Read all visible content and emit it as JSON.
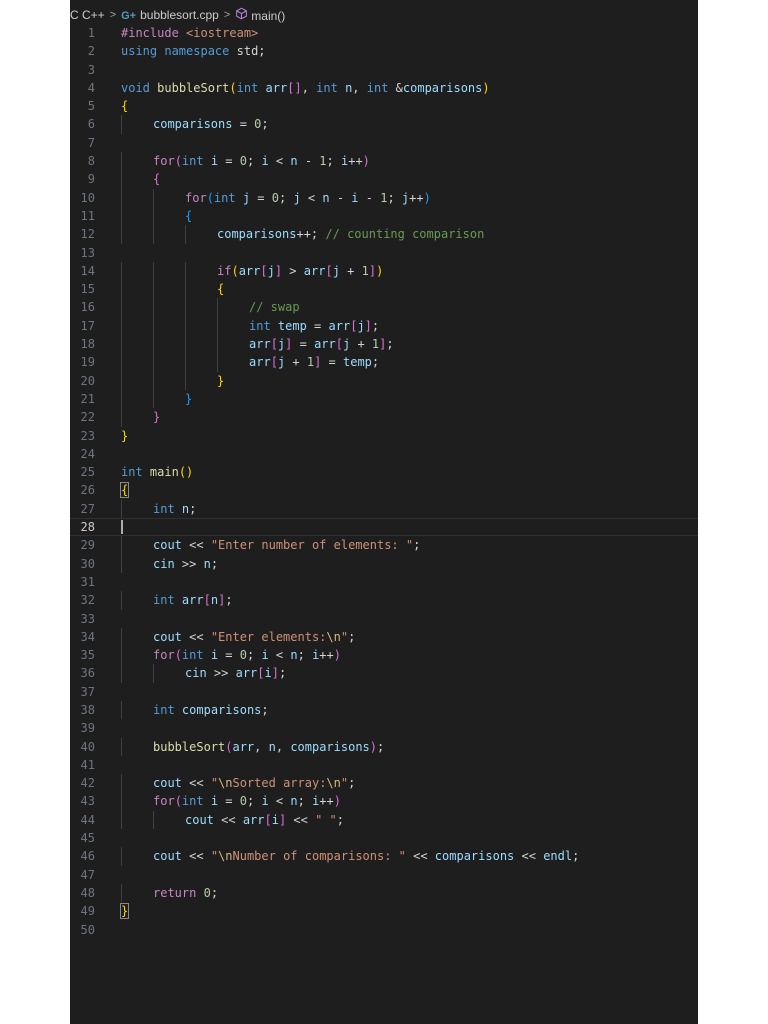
{
  "breadcrumb": {
    "items": [
      {
        "label": "C C++",
        "icon": null
      },
      {
        "label": "bubblesort.cpp",
        "icon": "cpp-file-icon"
      },
      {
        "label": "main()",
        "icon": "method-symbol-icon"
      }
    ],
    "separator": ">"
  },
  "editor": {
    "active_line": 28,
    "cursor_line": 28,
    "theme_colors": {
      "background": "#1e1e1e",
      "line_number": "#6e7681",
      "keyword": "#569cd6",
      "control": "#c586c0",
      "function": "#dcdcaa",
      "variable": "#9cdcfe",
      "number": "#b5cea8",
      "string": "#ce9178",
      "comment": "#6a9955"
    },
    "lines": [
      {
        "n": "1",
        "tokens": [
          [
            "pp",
            "#include "
          ],
          [
            "inc",
            "<iostream>"
          ]
        ]
      },
      {
        "n": "2",
        "tokens": [
          [
            "kw",
            "using"
          ],
          [
            "p",
            " "
          ],
          [
            "kw",
            "namespace"
          ],
          [
            "p",
            " std;"
          ]
        ]
      },
      {
        "n": "3",
        "tokens": []
      },
      {
        "n": "4",
        "tokens": [
          [
            "kw",
            "void"
          ],
          [
            "p",
            " "
          ],
          [
            "fn",
            "bubbleSort"
          ],
          [
            "b1",
            "("
          ],
          [
            "kw",
            "int"
          ],
          [
            "p",
            " "
          ],
          [
            "var",
            "arr"
          ],
          [
            "b2",
            "[]"
          ],
          [
            "p",
            ", "
          ],
          [
            "kw",
            "int"
          ],
          [
            "p",
            " "
          ],
          [
            "var",
            "n"
          ],
          [
            "p",
            ", "
          ],
          [
            "kw",
            "int"
          ],
          [
            "p",
            " &"
          ],
          [
            "var",
            "comparisons"
          ],
          [
            "b1",
            ")"
          ]
        ]
      },
      {
        "n": "5",
        "tokens": [
          [
            "b1",
            "{"
          ]
        ]
      },
      {
        "n": "6",
        "indent": 1,
        "tokens": [
          [
            "var",
            "comparisons"
          ],
          [
            "p",
            " = "
          ],
          [
            "num",
            "0"
          ],
          [
            "p",
            ";"
          ]
        ]
      },
      {
        "n": "7",
        "tokens": []
      },
      {
        "n": "8",
        "indent": 1,
        "tokens": [
          [
            "ctl",
            "for"
          ],
          [
            "b2",
            "("
          ],
          [
            "kw",
            "int"
          ],
          [
            "p",
            " "
          ],
          [
            "var",
            "i"
          ],
          [
            "p",
            " = "
          ],
          [
            "num",
            "0"
          ],
          [
            "p",
            "; "
          ],
          [
            "var",
            "i"
          ],
          [
            "p",
            " < "
          ],
          [
            "var",
            "n"
          ],
          [
            "p",
            " - "
          ],
          [
            "num",
            "1"
          ],
          [
            "p",
            "; "
          ],
          [
            "var",
            "i"
          ],
          [
            "p",
            "++"
          ],
          [
            "b2",
            ")"
          ]
        ]
      },
      {
        "n": "9",
        "indent": 1,
        "tokens": [
          [
            "b2",
            "{"
          ]
        ]
      },
      {
        "n": "10",
        "indent": 2,
        "tokens": [
          [
            "ctl",
            "for"
          ],
          [
            "b3",
            "("
          ],
          [
            "kw",
            "int"
          ],
          [
            "p",
            " "
          ],
          [
            "var",
            "j"
          ],
          [
            "p",
            " = "
          ],
          [
            "num",
            "0"
          ],
          [
            "p",
            "; "
          ],
          [
            "var",
            "j"
          ],
          [
            "p",
            " < "
          ],
          [
            "var",
            "n"
          ],
          [
            "p",
            " - "
          ],
          [
            "var",
            "i"
          ],
          [
            "p",
            " - "
          ],
          [
            "num",
            "1"
          ],
          [
            "p",
            "; "
          ],
          [
            "var",
            "j"
          ],
          [
            "p",
            "++"
          ],
          [
            "b3",
            ")"
          ]
        ]
      },
      {
        "n": "11",
        "indent": 2,
        "tokens": [
          [
            "b3",
            "{"
          ]
        ]
      },
      {
        "n": "12",
        "indent": 3,
        "tokens": [
          [
            "var",
            "comparisons"
          ],
          [
            "p",
            "++; "
          ],
          [
            "cmt",
            "// counting comparison"
          ]
        ]
      },
      {
        "n": "13",
        "tokens": []
      },
      {
        "n": "14",
        "indent": 3,
        "tokens": [
          [
            "ctl",
            "if"
          ],
          [
            "b1",
            "("
          ],
          [
            "var",
            "arr"
          ],
          [
            "b2",
            "["
          ],
          [
            "var",
            "j"
          ],
          [
            "b2",
            "]"
          ],
          [
            "p",
            " > "
          ],
          [
            "var",
            "arr"
          ],
          [
            "b2",
            "["
          ],
          [
            "var",
            "j"
          ],
          [
            "p",
            " + "
          ],
          [
            "num",
            "1"
          ],
          [
            "b2",
            "]"
          ],
          [
            "b1",
            ")"
          ]
        ]
      },
      {
        "n": "15",
        "indent": 3,
        "tokens": [
          [
            "b1",
            "{"
          ]
        ]
      },
      {
        "n": "16",
        "indent": 4,
        "tokens": [
          [
            "cmt",
            "// swap"
          ]
        ]
      },
      {
        "n": "17",
        "indent": 4,
        "tokens": [
          [
            "kw",
            "int"
          ],
          [
            "p",
            " "
          ],
          [
            "var",
            "temp"
          ],
          [
            "p",
            " = "
          ],
          [
            "var",
            "arr"
          ],
          [
            "b2",
            "["
          ],
          [
            "var",
            "j"
          ],
          [
            "b2",
            "]"
          ],
          [
            "p",
            ";"
          ]
        ]
      },
      {
        "n": "18",
        "indent": 4,
        "tokens": [
          [
            "var",
            "arr"
          ],
          [
            "b2",
            "["
          ],
          [
            "var",
            "j"
          ],
          [
            "b2",
            "]"
          ],
          [
            "p",
            " = "
          ],
          [
            "var",
            "arr"
          ],
          [
            "b2",
            "["
          ],
          [
            "var",
            "j"
          ],
          [
            "p",
            " + "
          ],
          [
            "num",
            "1"
          ],
          [
            "b2",
            "]"
          ],
          [
            "p",
            ";"
          ]
        ]
      },
      {
        "n": "19",
        "indent": 4,
        "tokens": [
          [
            "var",
            "arr"
          ],
          [
            "b2",
            "["
          ],
          [
            "var",
            "j"
          ],
          [
            "p",
            " + "
          ],
          [
            "num",
            "1"
          ],
          [
            "b2",
            "]"
          ],
          [
            "p",
            " = "
          ],
          [
            "var",
            "temp"
          ],
          [
            "p",
            ";"
          ]
        ]
      },
      {
        "n": "20",
        "indent": 3,
        "tokens": [
          [
            "b1",
            "}"
          ]
        ]
      },
      {
        "n": "21",
        "indent": 2,
        "tokens": [
          [
            "b3",
            "}"
          ]
        ]
      },
      {
        "n": "22",
        "indent": 1,
        "tokens": [
          [
            "b2",
            "}"
          ]
        ]
      },
      {
        "n": "23",
        "tokens": [
          [
            "b1",
            "}"
          ]
        ]
      },
      {
        "n": "24",
        "tokens": []
      },
      {
        "n": "25",
        "tokens": [
          [
            "kw",
            "int"
          ],
          [
            "p",
            " "
          ],
          [
            "fn",
            "main"
          ],
          [
            "b1",
            "()"
          ]
        ]
      },
      {
        "n": "26",
        "tokens": [
          [
            "b1",
            "{",
            "bm"
          ]
        ]
      },
      {
        "n": "27",
        "indent": 1,
        "tokens": [
          [
            "kw",
            "int"
          ],
          [
            "p",
            " "
          ],
          [
            "var",
            "n"
          ],
          [
            "p",
            ";"
          ]
        ]
      },
      {
        "n": "28",
        "tokens": []
      },
      {
        "n": "29",
        "indent": 1,
        "tokens": [
          [
            "var",
            "cout"
          ],
          [
            "p",
            " << "
          ],
          [
            "str",
            "\"Enter number of elements: \""
          ],
          [
            "p",
            ";"
          ]
        ]
      },
      {
        "n": "30",
        "indent": 1,
        "tokens": [
          [
            "var",
            "cin"
          ],
          [
            "p",
            " >> "
          ],
          [
            "var",
            "n"
          ],
          [
            "p",
            ";"
          ]
        ]
      },
      {
        "n": "31",
        "tokens": []
      },
      {
        "n": "32",
        "indent": 1,
        "tokens": [
          [
            "kw",
            "int"
          ],
          [
            "p",
            " "
          ],
          [
            "var",
            "arr"
          ],
          [
            "b2",
            "["
          ],
          [
            "var",
            "n"
          ],
          [
            "b2",
            "]"
          ],
          [
            "p",
            ";"
          ]
        ]
      },
      {
        "n": "33",
        "tokens": []
      },
      {
        "n": "34",
        "indent": 1,
        "tokens": [
          [
            "var",
            "cout"
          ],
          [
            "p",
            " << "
          ],
          [
            "str",
            "\"Enter elements:"
          ],
          [
            "esc",
            "\\n"
          ],
          [
            "str",
            "\""
          ],
          [
            "p",
            ";"
          ]
        ]
      },
      {
        "n": "35",
        "indent": 1,
        "tokens": [
          [
            "ctl",
            "for"
          ],
          [
            "b2",
            "("
          ],
          [
            "kw",
            "int"
          ],
          [
            "p",
            " "
          ],
          [
            "var",
            "i"
          ],
          [
            "p",
            " = "
          ],
          [
            "num",
            "0"
          ],
          [
            "p",
            "; "
          ],
          [
            "var",
            "i"
          ],
          [
            "p",
            " < "
          ],
          [
            "var",
            "n"
          ],
          [
            "p",
            "; "
          ],
          [
            "var",
            "i"
          ],
          [
            "p",
            "++"
          ],
          [
            "b2",
            ")"
          ]
        ]
      },
      {
        "n": "36",
        "indent": 2,
        "tokens": [
          [
            "var",
            "cin"
          ],
          [
            "p",
            " >> "
          ],
          [
            "var",
            "arr"
          ],
          [
            "b2",
            "["
          ],
          [
            "var",
            "i"
          ],
          [
            "b2",
            "]"
          ],
          [
            "p",
            ";"
          ]
        ]
      },
      {
        "n": "37",
        "tokens": []
      },
      {
        "n": "38",
        "indent": 1,
        "tokens": [
          [
            "kw",
            "int"
          ],
          [
            "p",
            " "
          ],
          [
            "var",
            "comparisons"
          ],
          [
            "p",
            ";"
          ]
        ]
      },
      {
        "n": "39",
        "tokens": []
      },
      {
        "n": "40",
        "indent": 1,
        "tokens": [
          [
            "fn",
            "bubbleSort"
          ],
          [
            "b2",
            "("
          ],
          [
            "var",
            "arr"
          ],
          [
            "p",
            ", "
          ],
          [
            "var",
            "n"
          ],
          [
            "p",
            ", "
          ],
          [
            "var",
            "comparisons"
          ],
          [
            "b2",
            ")"
          ],
          [
            "p",
            ";"
          ]
        ]
      },
      {
        "n": "41",
        "tokens": []
      },
      {
        "n": "42",
        "indent": 1,
        "tokens": [
          [
            "var",
            "cout"
          ],
          [
            "p",
            " << "
          ],
          [
            "str",
            "\""
          ],
          [
            "esc",
            "\\n"
          ],
          [
            "str",
            "Sorted array:"
          ],
          [
            "esc",
            "\\n"
          ],
          [
            "str",
            "\""
          ],
          [
            "p",
            ";"
          ]
        ]
      },
      {
        "n": "43",
        "indent": 1,
        "tokens": [
          [
            "ctl",
            "for"
          ],
          [
            "b2",
            "("
          ],
          [
            "kw",
            "int"
          ],
          [
            "p",
            " "
          ],
          [
            "var",
            "i"
          ],
          [
            "p",
            " = "
          ],
          [
            "num",
            "0"
          ],
          [
            "p",
            "; "
          ],
          [
            "var",
            "i"
          ],
          [
            "p",
            " < "
          ],
          [
            "var",
            "n"
          ],
          [
            "p",
            "; "
          ],
          [
            "var",
            "i"
          ],
          [
            "p",
            "++"
          ],
          [
            "b2",
            ")"
          ]
        ]
      },
      {
        "n": "44",
        "indent": 2,
        "tokens": [
          [
            "var",
            "cout"
          ],
          [
            "p",
            " << "
          ],
          [
            "var",
            "arr"
          ],
          [
            "b2",
            "["
          ],
          [
            "var",
            "i"
          ],
          [
            "b2",
            "]"
          ],
          [
            "p",
            " << "
          ],
          [
            "str",
            "\" \""
          ],
          [
            "p",
            ";"
          ]
        ]
      },
      {
        "n": "45",
        "tokens": []
      },
      {
        "n": "46",
        "indent": 1,
        "tokens": [
          [
            "var",
            "cout"
          ],
          [
            "p",
            " << "
          ],
          [
            "str",
            "\""
          ],
          [
            "esc",
            "\\n"
          ],
          [
            "str",
            "Number of comparisons: \""
          ],
          [
            "p",
            " << "
          ],
          [
            "var",
            "comparisons"
          ],
          [
            "p",
            " << "
          ],
          [
            "var",
            "endl"
          ],
          [
            "p",
            ";"
          ]
        ]
      },
      {
        "n": "47",
        "tokens": []
      },
      {
        "n": "48",
        "indent": 1,
        "tokens": [
          [
            "ctl",
            "return"
          ],
          [
            "p",
            " "
          ],
          [
            "num",
            "0"
          ],
          [
            "p",
            ";"
          ]
        ]
      },
      {
        "n": "49",
        "tokens": [
          [
            "b1",
            "}",
            "bm"
          ]
        ]
      },
      {
        "n": "50",
        "tokens": []
      }
    ]
  }
}
